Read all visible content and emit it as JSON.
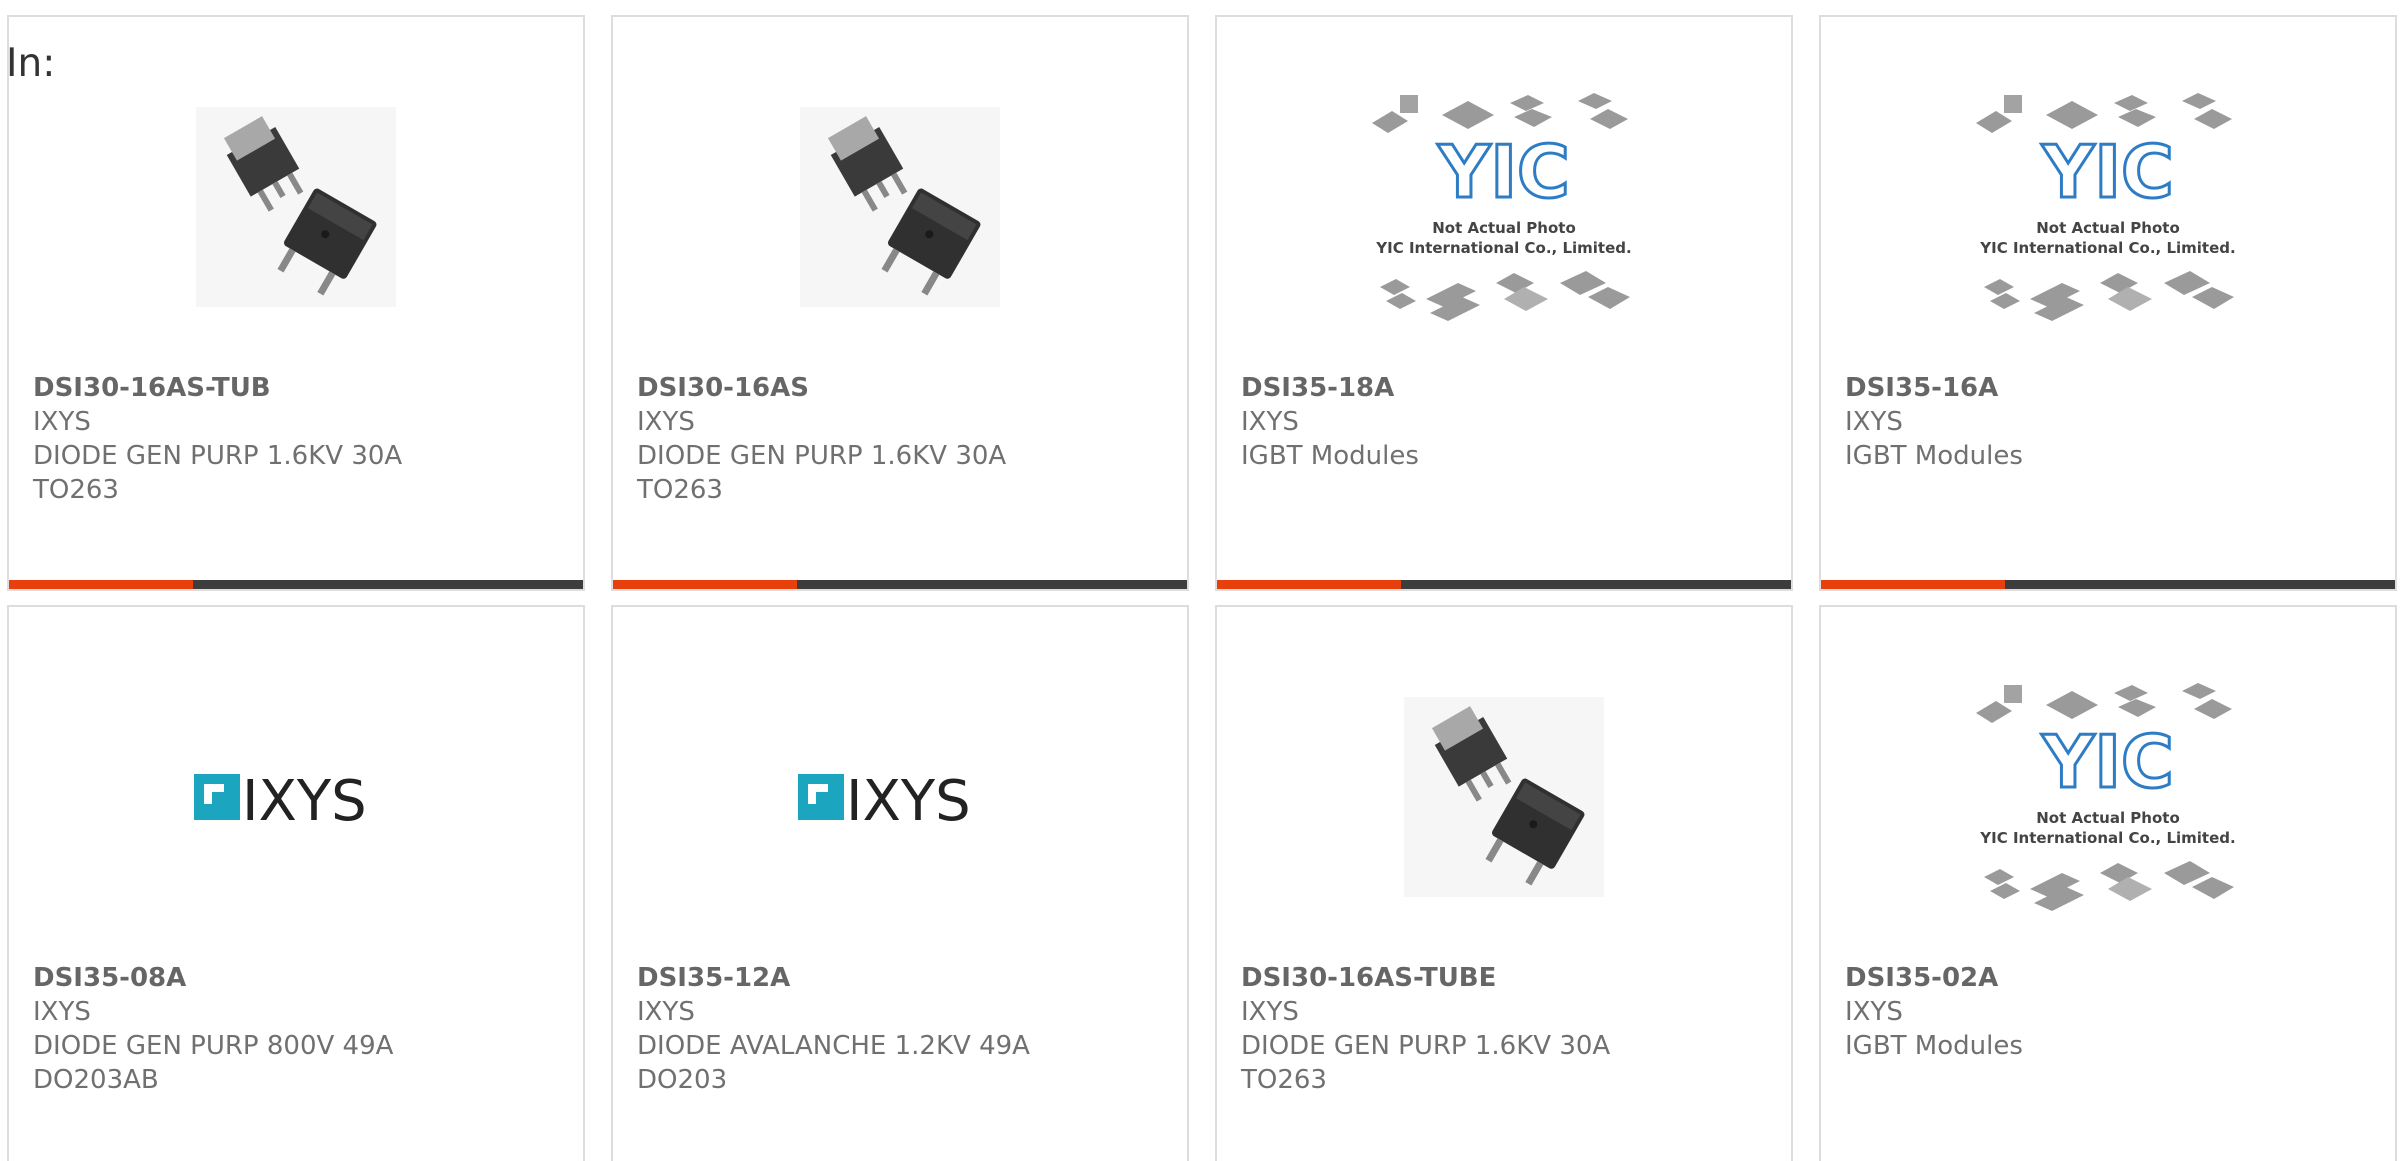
{
  "filter_label": "In:",
  "colors": {
    "accent_bar": "#e8400d",
    "dark_bar": "#3d3d3d",
    "ixys_logo": "#1ba5be",
    "yic_logo": "#2e7cc4"
  },
  "products": [
    {
      "part_number": "DSI30-16AS-TUB",
      "manufacturer": "IXYS",
      "description": "DIODE GEN PURP 1.6KV 30A",
      "package": "TO263",
      "image": "to263-package-photo"
    },
    {
      "part_number": "DSI30-16AS",
      "manufacturer": "IXYS",
      "description": "DIODE GEN PURP 1.6KV 30A",
      "package": "TO263",
      "image": "to263-package-photo"
    },
    {
      "part_number": "DSI35-18A",
      "manufacturer": "IXYS",
      "description": "IGBT Modules",
      "package": "",
      "image": "yic-placeholder",
      "placeholder_line1": "Not Actual Photo",
      "placeholder_line2": "YIC International Co., Limited.",
      "placeholder_logo": "YIC"
    },
    {
      "part_number": "DSI35-16A",
      "manufacturer": "IXYS",
      "description": "IGBT Modules",
      "package": "",
      "image": "yic-placeholder",
      "placeholder_line1": "Not Actual Photo",
      "placeholder_line2": "YIC International Co., Limited.",
      "placeholder_logo": "YIC"
    },
    {
      "part_number": "DSI35-08A",
      "manufacturer": "IXYS",
      "description": "DIODE GEN PURP 800V 49A",
      "package": "DO203AB",
      "image": "ixys-logo",
      "logo_text": "IXYS"
    },
    {
      "part_number": "DSI35-12A",
      "manufacturer": "IXYS",
      "description": "DIODE AVALANCHE 1.2KV 49A",
      "package": "DO203",
      "image": "ixys-logo",
      "logo_text": "IXYS"
    },
    {
      "part_number": "DSI30-16AS-TUBE",
      "manufacturer": "IXYS",
      "description": "DIODE GEN PURP 1.6KV 30A",
      "package": "TO263",
      "image": "to263-package-photo"
    },
    {
      "part_number": "DSI35-02A",
      "manufacturer": "IXYS",
      "description": "IGBT Modules",
      "package": "",
      "image": "yic-placeholder",
      "placeholder_line1": "Not Actual Photo",
      "placeholder_line2": "YIC International Co., Limited.",
      "placeholder_logo": "YIC"
    }
  ]
}
